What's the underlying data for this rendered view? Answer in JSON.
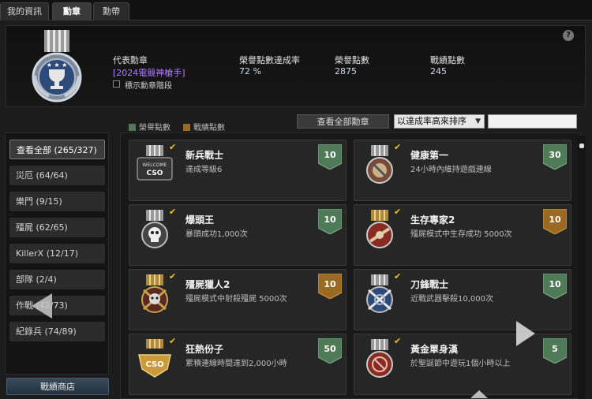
{
  "tabs": [
    "我的資訊",
    "勳章",
    "勳帶"
  ],
  "help_icon": "?",
  "summary": {
    "title_label": "代表勳章",
    "title_value": "[2024電競神槍手]",
    "rate_label": "榮譽點數達成率",
    "rate_value": "72 %",
    "honor_label": "榮譽點數",
    "honor_value": "2875",
    "war_label": "戰績點數",
    "war_value": "245",
    "show_stage_label": "標示勳章階段"
  },
  "menu": [
    "查看全部 (265/327)",
    "災厄 (64/64)",
    "樂門 (9/15)",
    "殭屍 (62/65)",
    "KillerX (12/17)",
    "部隊 (2/4)",
    "作戰 (42/73)",
    "紀錄兵 (74/89)"
  ],
  "shop_button": "戰績商店",
  "legend": {
    "honor": "榮譽點數",
    "war": "戰績點數"
  },
  "view_all_button": "查看全部勳章",
  "sort_select": "以達成率高來排序",
  "colors": {
    "honor_badge": "#4f7a57",
    "war_badge": "#9a6a22",
    "title": "#b07cff",
    "check": "#f0c030"
  },
  "cards": [
    {
      "title": "新兵戰士",
      "desc": "達成等級6",
      "points": "10",
      "kind": "honor",
      "icon": "welcome-medal-icon"
    },
    {
      "title": "健康第一",
      "desc": "24小時內維持遊戲連線",
      "points": "30",
      "kind": "honor",
      "icon": "health-medal-icon"
    },
    {
      "title": "爆頭王",
      "desc": "暴頭成功1,000次",
      "points": "10",
      "kind": "honor",
      "icon": "skull-medal-icon"
    },
    {
      "title": "生存專家2",
      "desc": "殭屍模式中生存成功 5000次",
      "points": "10",
      "kind": "war",
      "icon": "survivor-medal-icon"
    },
    {
      "title": "殭屍獵人2",
      "desc": "殭屍模式中射殺殭屍 5000次",
      "points": "10",
      "kind": "war",
      "icon": "zombie-hunter-medal-icon"
    },
    {
      "title": "刀鋒戰士",
      "desc": "近戰武器擊殺10,000次",
      "points": "10",
      "kind": "honor",
      "icon": "blade-medal-icon"
    },
    {
      "title": "狂熱份子",
      "desc": "累積連線時間達到2,000小時",
      "points": "50",
      "kind": "honor",
      "icon": "csd-medal-icon"
    },
    {
      "title": "黃金單身漢",
      "desc": "於聖誕節中遊玩1個小時以上",
      "points": "5",
      "kind": "honor",
      "icon": "bachelor-medal-icon"
    }
  ]
}
